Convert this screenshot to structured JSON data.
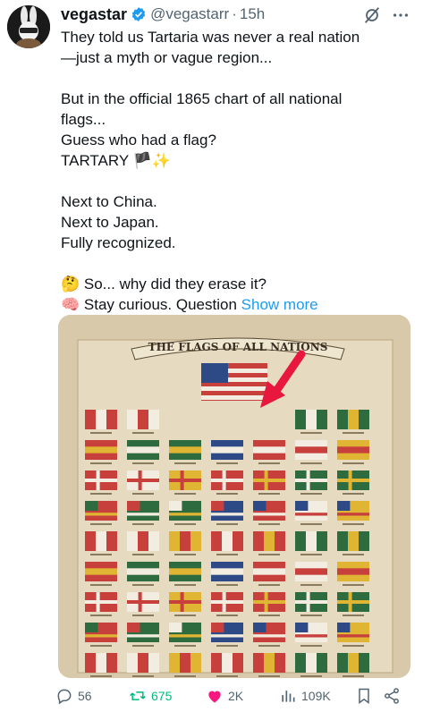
{
  "author": {
    "display_name": "vegastar",
    "handle": "@vegastarr",
    "separator": "·",
    "time": "15h",
    "more_label": "⋮"
  },
  "tweet": {
    "lines": [
      "They told us Tartaria was never a real nation",
      "—just a myth or vague region...",
      "",
      "But in the official 1865 chart of all national",
      "flags...",
      "Guess who had a flag?",
      "TARTARY 🏴✨",
      "",
      "Next to China.",
      "Next to Japan.",
      "Fully recognized.",
      "",
      "🤔 So... why did they erase it?",
      "🧠 Stay curious. Question"
    ],
    "show_more": "Show more"
  },
  "media": {
    "banner_text": "THE FLAGS OF ALL NATIONS",
    "arrow_color": "#e8173d"
  },
  "actions": {
    "replies": "56",
    "reposts": "675",
    "likes": "2K",
    "views": "109K"
  },
  "colors": {
    "accent": "#1d9bf0",
    "repost": "#00ba7c",
    "like": "#f91880",
    "muted": "#536471"
  }
}
